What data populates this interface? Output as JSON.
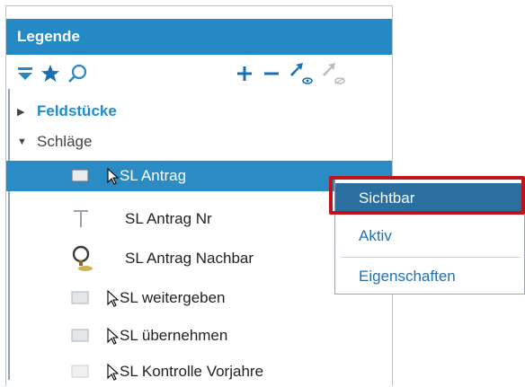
{
  "legend": {
    "title": "Legende",
    "toolbar": {
      "left_icons": [
        "filter-icon",
        "star-icon",
        "search-icon"
      ],
      "right_icons": [
        "plus-icon",
        "minus-icon",
        "visible-arrow-icon",
        "invisible-arrow-icon"
      ]
    },
    "groups": [
      {
        "label": "Feldstücke",
        "expanded": false,
        "color": "#2489c5"
      },
      {
        "label": "Schläge",
        "expanded": true,
        "color": "#444444"
      }
    ],
    "items": [
      {
        "label": "SL Antrag",
        "icon": "polygon-layer-icon",
        "cursor": true,
        "selected": true
      },
      {
        "label": "SL Antrag Nr",
        "icon": "text-layer-icon",
        "cursor": false,
        "selected": false
      },
      {
        "label": "SL Antrag Nachbar",
        "icon": "magnifier-layer-icon",
        "cursor": false,
        "selected": false
      },
      {
        "label": "SL weitergeben",
        "icon": "polygon-layer-icon",
        "cursor": true,
        "selected": false
      },
      {
        "label": "SL übernehmen",
        "icon": "polygon-layer-icon",
        "cursor": true,
        "selected": false
      },
      {
        "label": "SL Kontrolle Vorjahre",
        "icon": "polygon-faded-layer-icon",
        "cursor": true,
        "selected": false
      }
    ]
  },
  "context_menu": {
    "items": [
      {
        "label": "Sichtbar",
        "highlighted": true
      },
      {
        "label": "Aktiv",
        "highlighted": false
      },
      {
        "label": "Eigenschaften",
        "highlighted": false
      }
    ]
  },
  "colors": {
    "header": "#2489c5",
    "selection": "#2b8cc5",
    "menu_highlight": "#2a6f9f",
    "callout": "#c0141c"
  }
}
